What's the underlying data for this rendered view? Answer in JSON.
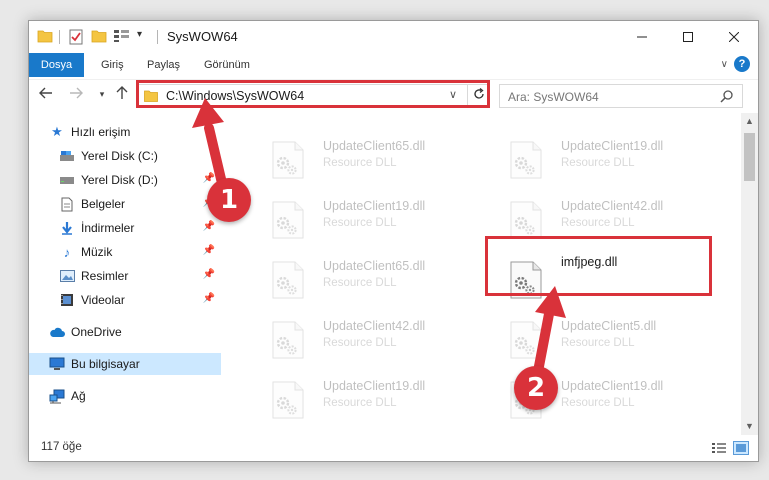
{
  "window": {
    "title": "SysWOW64"
  },
  "ribbon": {
    "tabs": [
      {
        "label": "Dosya",
        "active": true
      },
      {
        "label": "Giriş"
      },
      {
        "label": "Paylaş"
      },
      {
        "label": "Görünüm"
      }
    ],
    "help_label": "?"
  },
  "address": {
    "path": "C:\\Windows\\SysWOW64",
    "search_placeholder": "Ara: SysWOW64"
  },
  "sidebar": {
    "items": [
      {
        "label": "Hızlı erişim",
        "icon": "star-icon"
      },
      {
        "label": "Yerel Disk (C:)",
        "icon": "drive-icon",
        "pinned": true
      },
      {
        "label": "Yerel Disk (D:)",
        "icon": "drive-icon",
        "pinned": true
      },
      {
        "label": "Belgeler",
        "icon": "document-icon",
        "pinned": true
      },
      {
        "label": "İndirmeler",
        "icon": "download-icon",
        "pinned": true
      },
      {
        "label": "Müzik",
        "icon": "music-icon",
        "pinned": true
      },
      {
        "label": "Resimler",
        "icon": "pictures-icon",
        "pinned": true
      },
      {
        "label": "Videolar",
        "icon": "video-icon",
        "pinned": true
      },
      {
        "label": "OneDrive",
        "icon": "cloud-icon"
      },
      {
        "label": "Bu bilgisayar",
        "icon": "computer-icon",
        "selected": true
      },
      {
        "label": "Ağ",
        "icon": "network-icon"
      }
    ]
  },
  "files": [
    {
      "name": "UpdateClient65.dll",
      "type": "Resource DLL",
      "faded": true
    },
    {
      "name": "UpdateClient19.dll",
      "type": "Resource DLL",
      "faded": true
    },
    {
      "name": "UpdateClient19.dll",
      "type": "Resource DLL",
      "faded": true
    },
    {
      "name": "UpdateClient42.dll",
      "type": "Resource DLL",
      "faded": true
    },
    {
      "name": "UpdateClient65.dll",
      "type": "Resource DLL",
      "faded": true
    },
    {
      "name": "imfjpeg.dll",
      "type": "",
      "faded": false
    },
    {
      "name": "UpdateClient42.dll",
      "type": "Resource DLL",
      "faded": true
    },
    {
      "name": "UpdateClient5.dll",
      "type": "Resource DLL",
      "faded": true
    },
    {
      "name": "UpdateClient19.dll",
      "type": "Resource DLL",
      "faded": true
    },
    {
      "name": "UpdateClient19.dll",
      "type": "Resource DLL",
      "faded": true
    }
  ],
  "status": {
    "count": "117 öğe"
  },
  "annotations": {
    "step1": "1",
    "step2": "2",
    "color": "#d9323a"
  },
  "colors": {
    "accent": "#1979ca",
    "selection": "#cce8ff"
  }
}
